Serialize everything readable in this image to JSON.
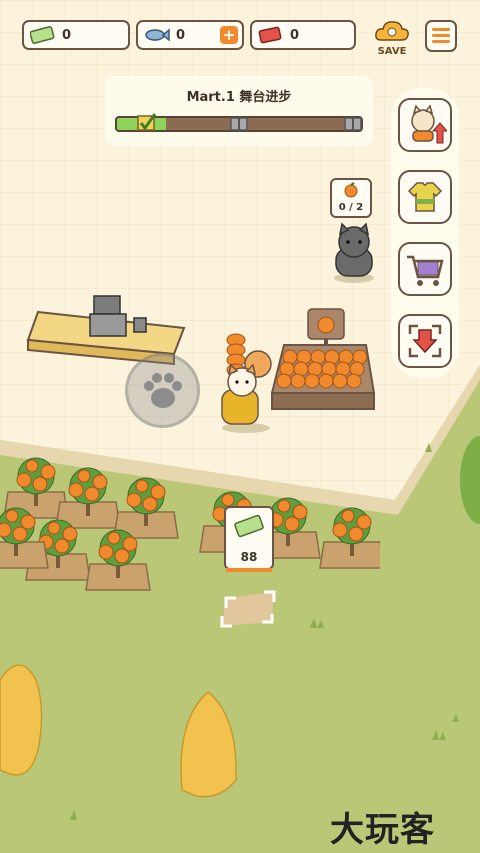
{
  "currencies": [
    {
      "name": "cash",
      "value": "0"
    },
    {
      "name": "fish",
      "value": "0"
    },
    {
      "name": "ticket",
      "value": "0"
    }
  ],
  "top": {
    "save_label": "SAVE",
    "menu_icon": "menu-icon"
  },
  "progress": {
    "title": "Mart.1 舞台进步",
    "fraction": 0.2
  },
  "customer_bubble": {
    "count": "0 / 2"
  },
  "cash_pile": {
    "amount": "88"
  },
  "watermark": "大玩客",
  "side_buttons": [
    "cat-staff-upgrade-icon",
    "shirt-upgrade-icon",
    "shopping-cart-icon",
    "rearrange-icon"
  ],
  "colors": {
    "ground_tile": "#fbf3dc",
    "grass": "#b9c777",
    "accent_orange": "#f08a2c",
    "progress_fill": "#8ed35a"
  }
}
